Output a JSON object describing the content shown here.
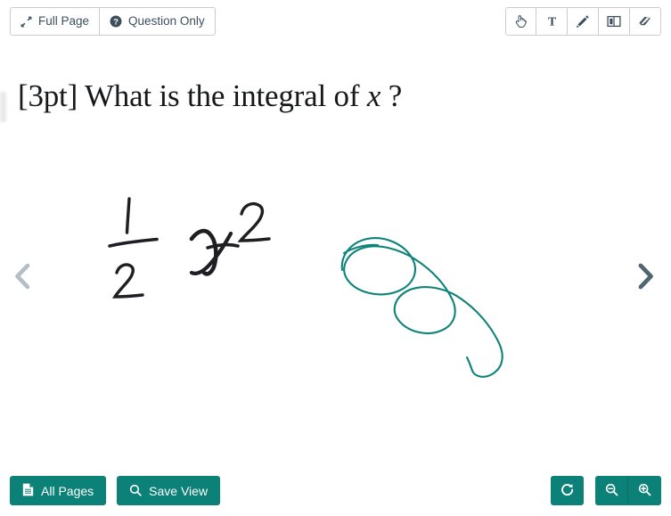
{
  "colors": {
    "teal": "#0c8177",
    "ink_annotation": "#0d8379",
    "toolbar_text": "#3c4f5c",
    "border": "#cccccc",
    "nav_enabled": "#4f6572",
    "nav_disabled": "#b4bec6",
    "handwriting": "#1b1b1f",
    "question_text": "#16181a"
  },
  "toolbar": {
    "view_modes": [
      {
        "label": "Full Page",
        "icon": "expand-arrows-icon"
      },
      {
        "label": "Question Only",
        "icon": "question-circle-icon"
      }
    ],
    "tools": [
      {
        "name": "pan-tool",
        "icon": "hand-pointer-icon",
        "title": "Pan"
      },
      {
        "name": "text-tool",
        "icon": "text-t-icon",
        "title": "Text"
      },
      {
        "name": "pen-tool",
        "icon": "pencil-icon",
        "title": "Pen"
      },
      {
        "name": "columns-tool",
        "icon": "columns-icon",
        "title": "Columns"
      },
      {
        "name": "eraser-tool",
        "icon": "eraser-icon",
        "title": "Eraser"
      }
    ]
  },
  "document": {
    "question_prefix": "[3pt] What is the integral of ",
    "question_variable": "x",
    "question_suffix": " ?",
    "handwritten_answer": "1/2 x^2",
    "annotation": "teal freehand loop scribble"
  },
  "navigation": {
    "prev_label": "Previous",
    "prev_icon": "chevron-left-icon",
    "prev_enabled": false,
    "next_label": "Next",
    "next_icon": "chevron-right-icon",
    "next_enabled": true
  },
  "footer": {
    "left_buttons": [
      {
        "label": "All Pages",
        "icon": "file-document-icon"
      },
      {
        "label": "Save View",
        "icon": "magnifier-icon"
      }
    ],
    "right_buttons": [
      {
        "label": "",
        "name": "rotate-button",
        "icon": "rotate-right-icon"
      },
      {
        "label": "",
        "name": "zoom-out-button",
        "icon": "zoom-out-icon"
      },
      {
        "label": "",
        "name": "zoom-in-button",
        "icon": "zoom-in-icon"
      }
    ]
  }
}
